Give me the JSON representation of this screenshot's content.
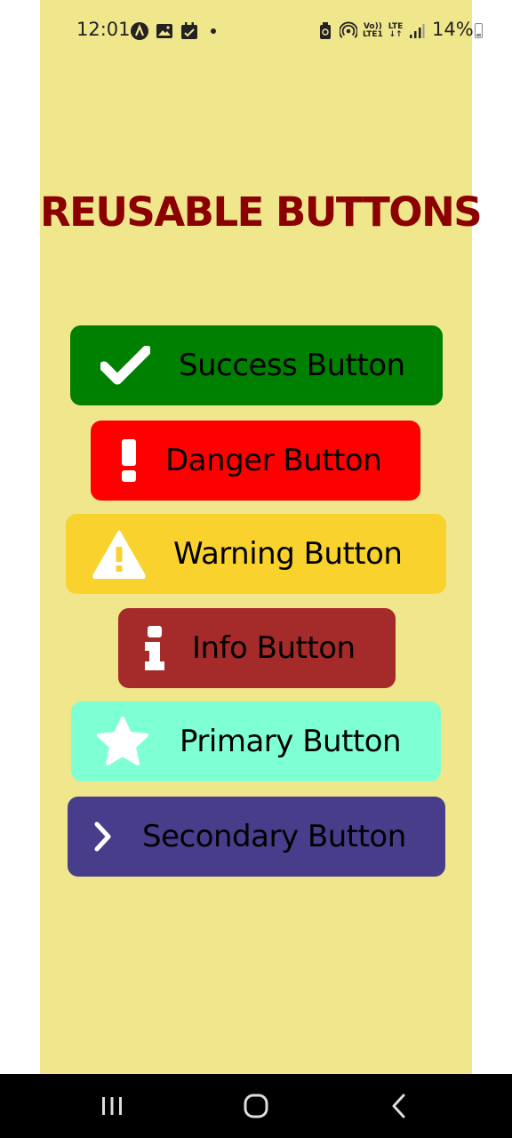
{
  "status_bar": {
    "time": "12:01",
    "battery": "14%",
    "left_icons": [
      "auto-icon",
      "image-icon",
      "calendar-icon",
      "notification-dot-icon"
    ],
    "right_icons": [
      "battery-saver-icon",
      "hotspot-icon",
      "volte-icon",
      "lte-data-icon",
      "signal-icon",
      "battery-icon"
    ],
    "volte_text_top": "Vo))",
    "volte_text_bottom": "LTE1",
    "lte_text": "LTE"
  },
  "page": {
    "title": "REUSABLE BUTTONS",
    "title_color": "#8B0000",
    "background": "#F0E68C"
  },
  "buttons": [
    {
      "label": "Success Button",
      "icon": "check-icon",
      "color": "#008000"
    },
    {
      "label": "Danger Button",
      "icon": "exclamation-icon",
      "color": "#FF0000"
    },
    {
      "label": "Warning Button",
      "icon": "warning-icon",
      "color": "#F9D22E"
    },
    {
      "label": "Info Button",
      "icon": "info-icon",
      "color": "#A52A2A"
    },
    {
      "label": "Primary Button",
      "icon": "star-icon",
      "color": "#7FFFD4"
    },
    {
      "label": "Secondary Button",
      "icon": "chevron-right-icon",
      "color": "#483D8B"
    }
  ],
  "nav_bar": {
    "items": [
      "recent-apps-icon",
      "home-icon",
      "back-icon"
    ]
  }
}
